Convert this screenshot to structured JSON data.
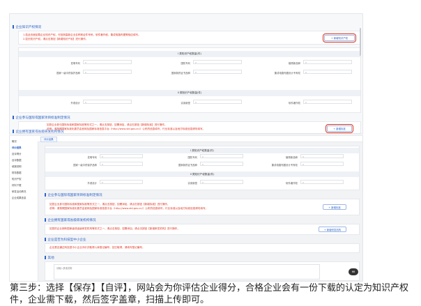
{
  "top": {
    "section1_title": "企业知识产权情况",
    "section1_notes": [
      "1.若此页面加载企业知识产权，可回到高新企业名称和证件号码，软件著作权、集成电路布图等相应填写。",
      "2.如无知识产权，请点击按钮【新增知识产权】进行操作。"
    ],
    "add_ip_button": "+ 新增知识产权",
    "card1_title": "I 类知识产权数量(件)",
    "row1": [
      {
        "label": "发明专利",
        "value": "0"
      },
      {
        "label": "国防专利",
        "value": "0"
      },
      {
        "label": "植物新品种",
        "value": "0"
      }
    ],
    "row2": [
      {
        "label": "国家一级中药保护品种",
        "value": "0"
      },
      {
        "label": "国家新药证书品种",
        "value": "0"
      },
      {
        "label": "集成电路布图设计专有权",
        "value": "0"
      }
    ],
    "card2_title": "II 类知识产权数量(件)",
    "row3": [
      {
        "label": "外观设计",
        "value": "0"
      },
      {
        "label": "实用新型",
        "value": "0"
      },
      {
        "label": "软件著作权",
        "value": "0"
      }
    ],
    "section2_title": "企业参与国际或国家项目标准制定情况",
    "section2_notes": [
      "如您企业参与国际标准和国家标准等形式之一，请点击按钮，如需添加，请点击按钮【新增标准】进行操作。",
      "说明：请按照国家标准化委员会官网及国家标准信息平台（http://www.std.gov.cn/）公布的信息填写，行业标准以及地方标准信息请勿填写。"
    ],
    "add_standard_button": "+ 新增标准",
    "section3_title": "企业拥有国家或省级研发机构情况",
    "badge": "66"
  },
  "bottom": {
    "sidebar": [
      {
        "label": "概况",
        "active": false
      },
      {
        "label": "评价结果",
        "active": true
      },
      {
        "label": "自评得分",
        "active": false
      },
      {
        "label": "自评数据",
        "active": false
      },
      {
        "label": "填报说明",
        "active": false
      },
      {
        "label": "财务数据",
        "active": false
      },
      {
        "label": "知识产权",
        "active": false
      },
      {
        "label": "材料下载",
        "active": false
      },
      {
        "label": "研发活动情况",
        "active": false
      },
      {
        "label": "企业成果信息",
        "active": false
      }
    ],
    "tab": "评价结果",
    "card1_title": "I 类知识产权数量(件)",
    "row1": [
      {
        "label": "发明专利",
        "value": "0"
      },
      {
        "label": "国防专利",
        "value": "0"
      },
      {
        "label": "植物新品种",
        "value": "0"
      }
    ],
    "row2": [
      {
        "label": "国家一级中药保护品种",
        "value": "0"
      },
      {
        "label": "国家新药证书品种",
        "value": "0"
      },
      {
        "label": "集成电路布图设计专有权",
        "value": "0"
      }
    ],
    "card2_title": "II 类知识产权数量(件)",
    "row3": [
      {
        "label": "外观设计",
        "value": "0"
      },
      {
        "label": "实用新型",
        "value": "0"
      },
      {
        "label": "软件著作权",
        "value": "0"
      }
    ],
    "sec_standard_title": "企业参与国际或国家项目标准制定情况",
    "sec_standard_notes": [
      "如您企业参与国际标准和国家标准等形式之一，请点击按钮，如需添加，请点击按钮【新增标准】进行操作。",
      "说明：请按照国家标准化委员会官网及国家标准信息平台（http://www.std.gov.cn/）公布的信息填写，行业标准以及地方标准信息请勿填写。"
    ],
    "add_standard_button": "+ 新增标准",
    "sec_rd_title": "企业拥有国家或省级研发机构情况",
    "sec_rd_note": "如您的企业拥有国家级或省级研发机构等形式之一，请点击按钮，如需添加，请点击按钮【新增研发机构】进行操作。",
    "add_rd_button": "+ 新增研发机构",
    "sec_cert_title": "企业是否为科技型中小企业",
    "sec_cert_note": "企业是否通过科技型中小企业评价并取得入库登记编号，如已取得，请填写登记编号。",
    "sec_other_title": "其他",
    "other_placeholder": "请输入其他说明",
    "badge": "66"
  },
  "caption": "第三步：选择【保存】【自评】，网站会为你评估企业得分，合格企业会有一份下载的认定为知识产权件，企业需下载，然后签字盖章，扫描上传即可。"
}
